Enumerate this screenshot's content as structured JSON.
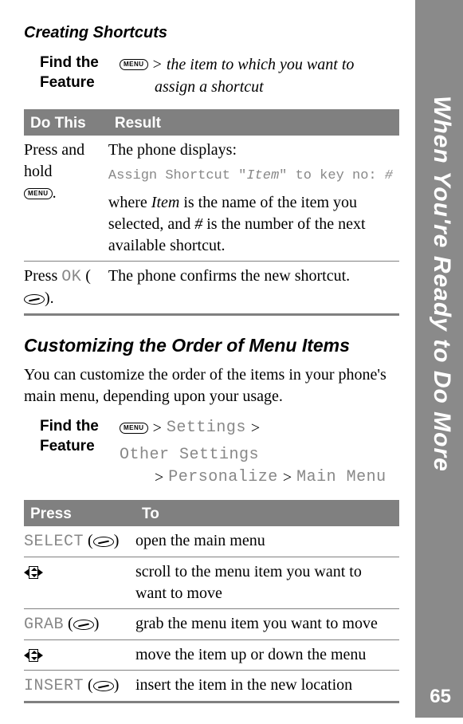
{
  "sideTab": "When You're Ready to Do More",
  "pageNumber": "65",
  "section1": {
    "heading": "Creating Shortcuts",
    "findFeatureLabel": "Find the Feature",
    "menuLabel": "MENU",
    "gt": ">",
    "pathLine1": "the item to which you want to",
    "pathLine2": "assign a shortcut",
    "table": {
      "headers": {
        "c1": "Do This",
        "c2": "Result"
      },
      "rows": [
        {
          "c1a": "Press and hold",
          "c1b": ".",
          "c2_intro": "The phone displays:",
          "assign_pre": "Assign Shortcut \"",
          "assign_item": "Item",
          "assign_mid": "\" to key no: ",
          "assign_hash": "#",
          "c2_body_a": "where ",
          "c2_body_item": "Item",
          "c2_body_b": " is the name of the item you selected, and ",
          "c2_body_hash": "#",
          "c2_body_c": " is the number of the next available shortcut."
        },
        {
          "c1a": "Press ",
          "c1_ok": "OK",
          "c1b": " (",
          "c1c": ").",
          "c2": "The phone confirms the new shortcut."
        }
      ]
    }
  },
  "section2": {
    "heading": "Customizing the Order of Menu Items",
    "body": "You can customize the order of the items in your phone's main menu, depending upon your usage.",
    "findFeatureLabel": "Find the Feature",
    "menuLabel": "MENU",
    "gt": ">",
    "path": {
      "p1": "Settings",
      "p2": "Other Settings",
      "p3": "Personalize",
      "p4": "Main Menu"
    },
    "table": {
      "headers": {
        "c1": "Press",
        "c2": "To"
      },
      "rows": [
        {
          "c1": "SELECT",
          "c2": "open the main menu"
        },
        {
          "nav": true,
          "c2": "scroll to the menu item you want to want to move"
        },
        {
          "c1": "GRAB",
          "c2": "grab the menu item you want to move"
        },
        {
          "nav": true,
          "c2": "move the item up or down the menu"
        },
        {
          "c1": "INSERT",
          "c2": "insert the item in the new location"
        }
      ],
      "lp": " (",
      "rp": ")"
    }
  }
}
